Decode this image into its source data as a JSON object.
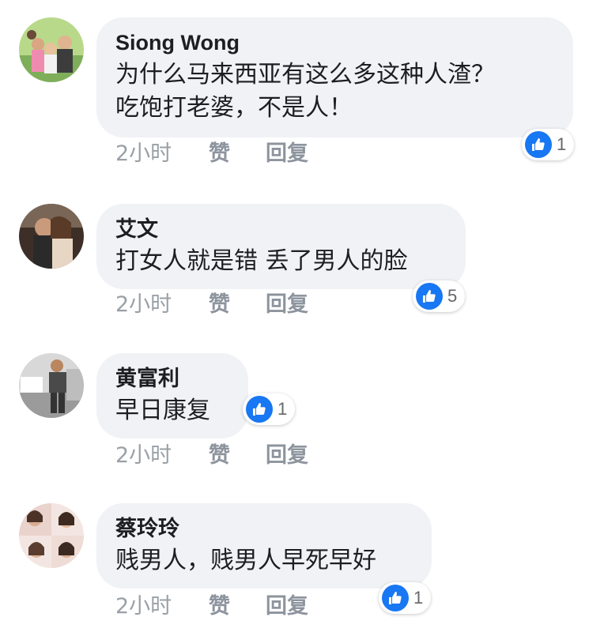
{
  "comments": [
    {
      "author": "Siong Wong",
      "text_lines": [
        "为什么马来西亚有这么多这种人渣？",
        "吃饱打老婆，不是人！"
      ],
      "time": "2小时",
      "like_label": "赞",
      "reply_label": "回复",
      "reaction_icon": "like-icon",
      "reaction_count": "1"
    },
    {
      "author": "艾文",
      "text_lines": [
        "打女人就是错 丢了男人的脸"
      ],
      "time": "2小时",
      "like_label": "赞",
      "reply_label": "回复",
      "reaction_icon": "like-icon",
      "reaction_count": "5"
    },
    {
      "author": "黄富利",
      "text_lines": [
        "早日康复"
      ],
      "time": "2小时",
      "like_label": "赞",
      "reply_label": "回复",
      "reaction_icon": "like-icon",
      "reaction_count": "1"
    },
    {
      "author": "蔡玲玲",
      "text_lines": [
        "贱男人，贱男人早死早好"
      ],
      "time": "2小时",
      "like_label": "赞",
      "reply_label": "回复",
      "reaction_icon": "like-icon",
      "reaction_count": "1"
    }
  ],
  "colors": {
    "bubble": "#f0f2f5",
    "like_blue": "#1877f2",
    "meta_gray": "#9aa0a6"
  }
}
